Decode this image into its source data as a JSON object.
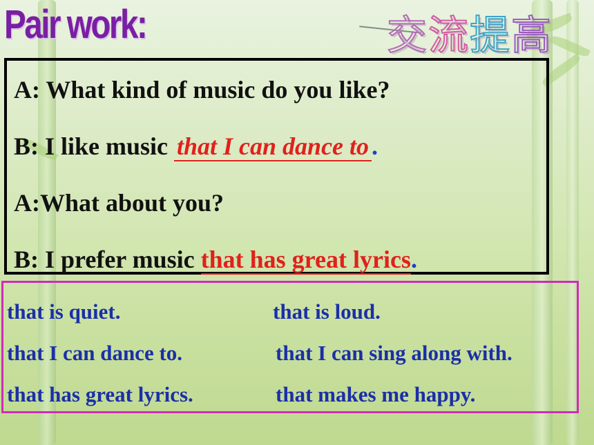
{
  "header": {
    "title_en": "Pair work:",
    "title_zh": [
      "交",
      "流",
      "提",
      "高"
    ]
  },
  "dialog": {
    "line1": "A: What kind of music do you like?",
    "line2_prefix": "B: I like music ",
    "line2_answer": "that I can dance to",
    "line2_end": ".",
    "line3": "A:What about you?",
    "line4_prefix": "B: I prefer music ",
    "line4_answer": "that has great lyrics",
    "line4_end": "."
  },
  "options": {
    "r1c1": "that is quiet.",
    "r1c2": "that is loud.",
    "r2c1": "that I can dance to.",
    "r2c2": "that I can sing along with.",
    "r3c1": "that has great lyrics.",
    "r3c2": "that makes me happy."
  }
}
